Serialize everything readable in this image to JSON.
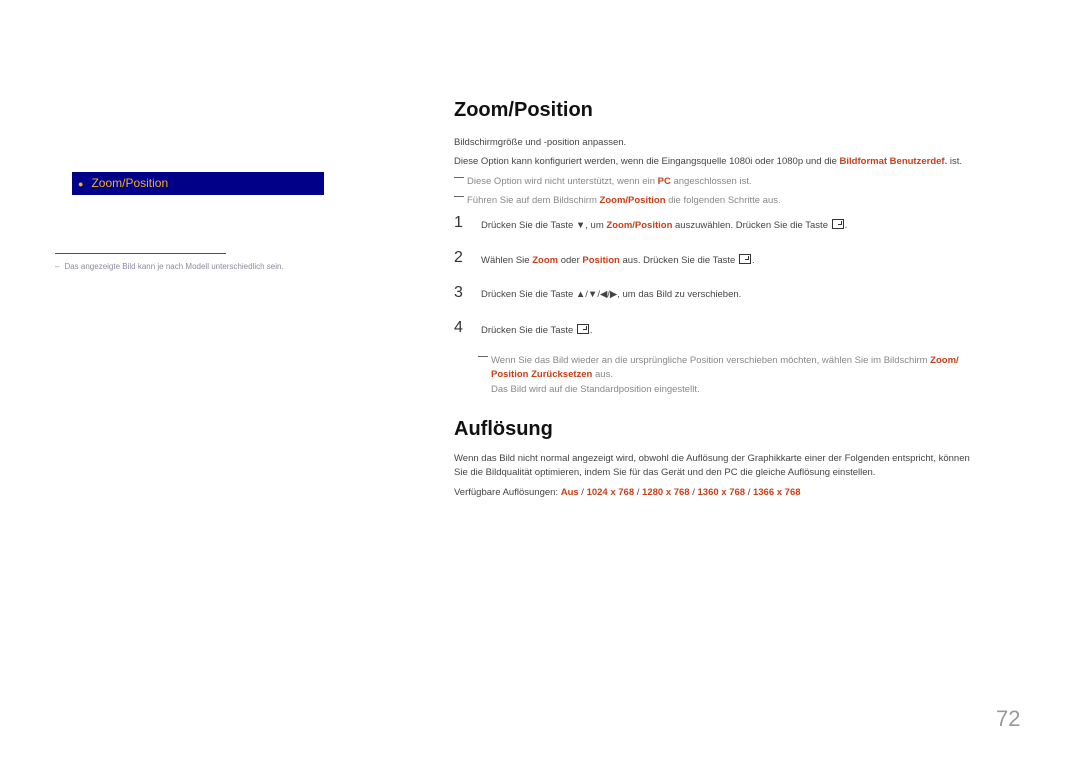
{
  "sidebar": {
    "active_item": "Zoom/Position",
    "footnote": "Das angezeigte Bild kann je nach Modell unterschiedlich sein."
  },
  "section1": {
    "title": "Zoom/Position",
    "intro": "Bildschirmgröße und -position anpassen.",
    "condition_pre": "Diese Option kann konfiguriert werden, wenn die Eingangsquelle 1080i oder 1080p und die ",
    "condition_hl": "Bildformat Benutzerdef.",
    "condition_post": " ist.",
    "note1_pre": "Diese Option wird nicht unterstützt, wenn ein ",
    "note1_hl": "PC",
    "note1_post": " angeschlossen ist.",
    "note2_pre": "Führen Sie auf dem Bildschirm ",
    "note2_hl": "Zoom/Position",
    "note2_post": " die folgenden Schritte aus.",
    "steps": [
      {
        "num": "1",
        "a": "Drücken Sie die Taste ▼, um ",
        "hl": "Zoom/Position",
        "b": " auszuwählen. Drücken Sie die Taste "
      },
      {
        "num": "2",
        "a": "Wählen Sie ",
        "hl": "Zoom",
        "mid": " oder ",
        "hl2": "Position",
        "b": " aus. Drücken Sie die Taste "
      },
      {
        "num": "3",
        "a": "Drücken Sie die Taste ▲/▼/◀/▶, um das Bild zu verschieben."
      },
      {
        "num": "4",
        "a": "Drücken Sie die Taste "
      }
    ],
    "reset_note_pre": "Wenn Sie das Bild wieder an die ursprüngliche Position verschieben möchten, wählen Sie im Bildschirm ",
    "reset_note_hl1": "Zoom/",
    "reset_note_hl2": "Position Zurücksetzen",
    "reset_note_post": " aus.",
    "reset_note_line2": "Das Bild wird auf die Standardposition eingestellt."
  },
  "section2": {
    "title": "Auflösung",
    "body_line1": "Wenn das Bild nicht normal angezeigt wird, obwohl die Auflösung der Graphikkarte einer der Folgenden entspricht, können",
    "body_line2": "Sie die Bildqualität optimieren, indem Sie für das Gerät und den PC die gleiche Auflösung einstellen.",
    "resolutions_label": "Verfügbare Auflösungen: ",
    "resolutions": [
      "Aus",
      "1024 x 768",
      "1280 x 768",
      "1360 x 768",
      "1366 x 768"
    ],
    "separator": " / "
  },
  "page_number": "72"
}
